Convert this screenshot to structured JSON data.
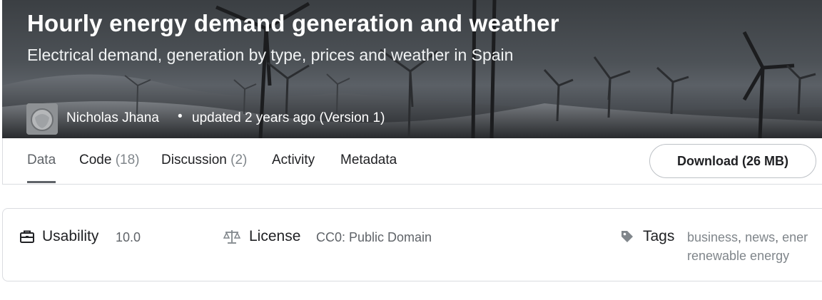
{
  "dataset": {
    "title": "Hourly energy demand generation and weather",
    "subtitle": "Electrical demand, generation by type, prices and weather in Spain",
    "author": "Nicholas Jhana",
    "separator": "•",
    "updated": "updated 2 years ago (Version 1)"
  },
  "tabs": [
    {
      "label": "Data",
      "count": ""
    },
    {
      "label": "Code",
      "count": "(18)"
    },
    {
      "label": "Discussion",
      "count": "(2)"
    },
    {
      "label": "Activity",
      "count": ""
    },
    {
      "label": "Metadata",
      "count": ""
    }
  ],
  "download": {
    "label": "Download (26 MB)"
  },
  "info": {
    "usability": {
      "label": "Usability",
      "value": "10.0",
      "icon": "briefcase-icon"
    },
    "license": {
      "label": "License",
      "value": "CC0: Public Domain",
      "icon": "scale-icon"
    },
    "tags": {
      "label": "Tags",
      "icon": "tag-icon",
      "items": [
        "business",
        "news",
        "ener"
      ],
      "items_line2": [
        "renewable energy"
      ],
      "separator": ","
    }
  },
  "colors": {
    "accent_tab": "#5f6368",
    "border": "#dadce0",
    "text_muted": "#80868b"
  }
}
